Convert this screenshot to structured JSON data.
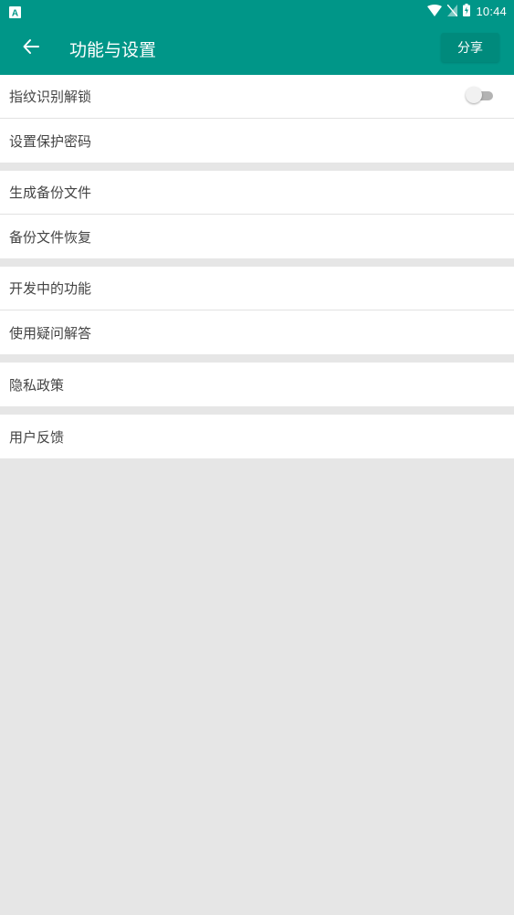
{
  "status_bar": {
    "time": "10:44"
  },
  "app_bar": {
    "title": "功能与设置",
    "share_label": "分享"
  },
  "colors": {
    "primary": "#009688",
    "background": "#e6e6e6"
  },
  "groups": [
    {
      "items": [
        {
          "label": "指纹识别解锁",
          "toggle_on": false
        },
        {
          "label": "设置保护密码"
        }
      ]
    },
    {
      "items": [
        {
          "label": "生成备份文件"
        },
        {
          "label": "备份文件恢复"
        }
      ]
    },
    {
      "items": [
        {
          "label": "开发中的功能"
        },
        {
          "label": "使用疑问解答"
        }
      ]
    },
    {
      "items": [
        {
          "label": "隐私政策"
        }
      ]
    },
    {
      "items": [
        {
          "label": "用户反馈"
        }
      ]
    }
  ]
}
